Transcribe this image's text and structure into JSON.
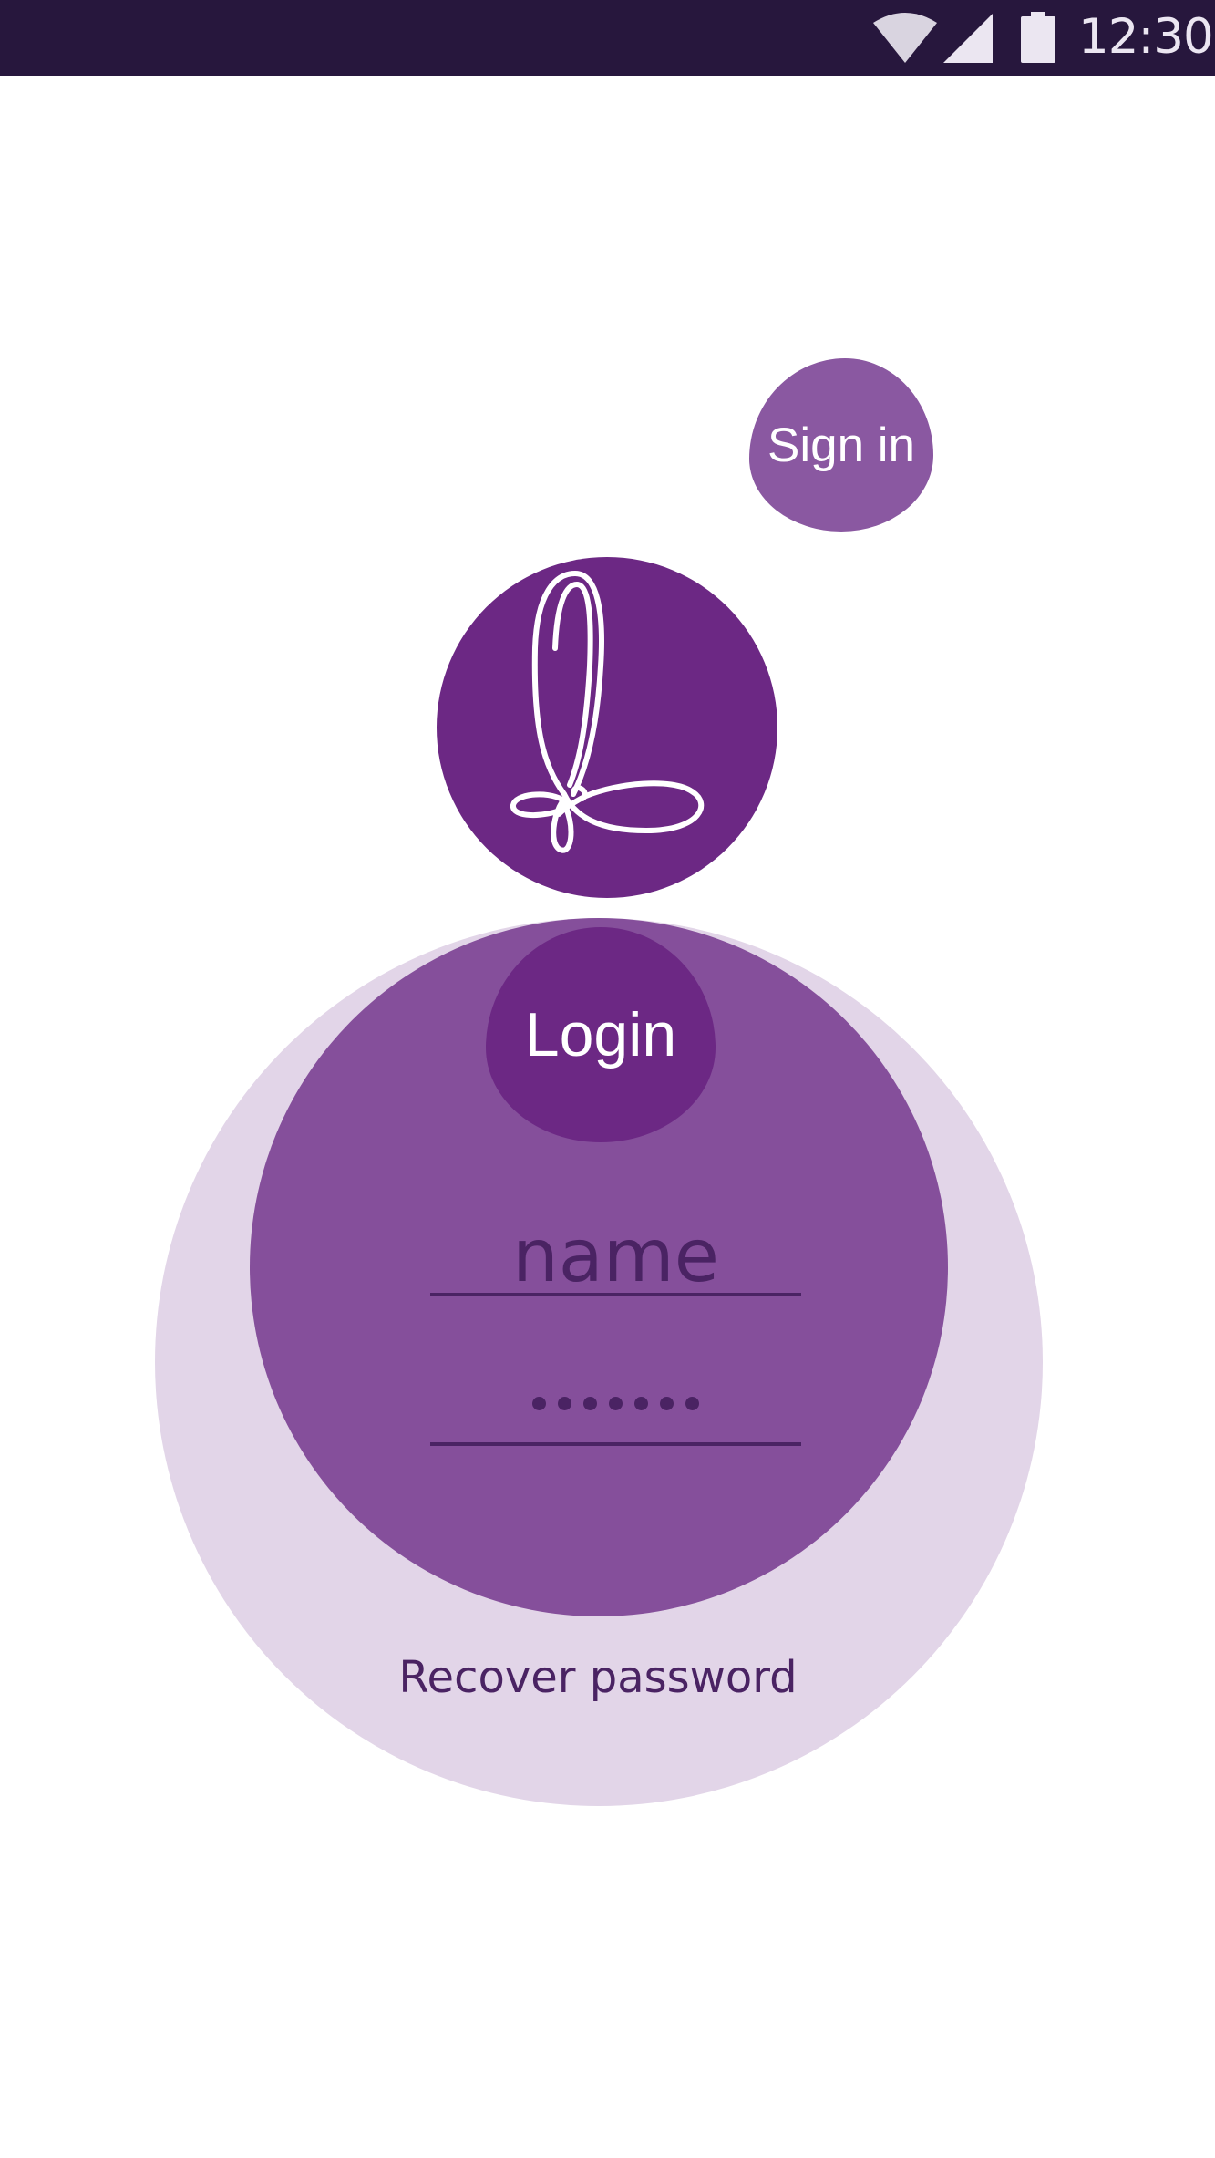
{
  "status_bar": {
    "time": "12:30",
    "icons": [
      "wifi-icon",
      "cellular-signal-icon",
      "battery-icon"
    ]
  },
  "signin": {
    "label": "Sign in"
  },
  "logo": {
    "icon": "app-logo-icon"
  },
  "login_form": {
    "title": "Login",
    "name_value": "name",
    "password_value": "•••••••",
    "recover_label": "Recover password"
  },
  "colors": {
    "status_bar_bg": "#27173d",
    "primary": "#6c2884",
    "secondary": "#854f9b",
    "signin_bubble": "#8a58a1",
    "outer_circle": "#e2d5e8",
    "text_dark": "#4a2363"
  }
}
